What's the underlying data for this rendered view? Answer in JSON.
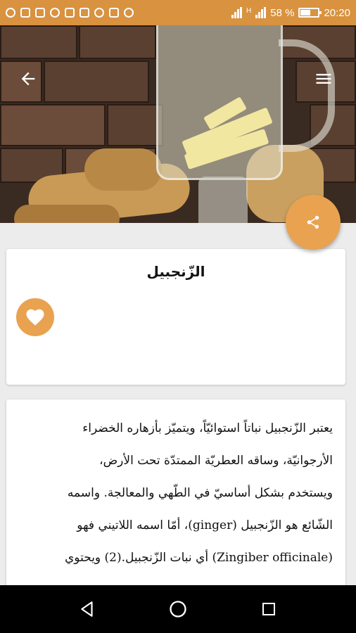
{
  "status_bar": {
    "battery_percent": "58 %",
    "time": "20:20",
    "notification_icons": [
      "hotspot-icon",
      "sim-icon",
      "facebook-icon",
      "messenger-icon",
      "gallery-icon",
      "app-icon",
      "app-icon-2",
      "instagram-icon",
      "messenger-icon-2"
    ],
    "signal_label": "H",
    "battery_level": 0.58
  },
  "toolbar": {
    "back_icon": "arrow-back-icon",
    "menu_icon": "menu-icon"
  },
  "article": {
    "title": "الزّنجبيل",
    "share_icon": "share-icon",
    "favorite_icon": "heart-icon",
    "content_lines": [
      "يعتبر الزّنجبيل نباتاً استوائيّاً، ويتميّز بأزهاره الخضراء",
      "الأرجوانيّة، وساقه العطريّة الممتدّة تحت الأرض،",
      "ويستخدم بشكل أساسيّ في الطّهي والمعالجة. واسمه",
      "الشّائع هو الزّنجبيل (ginger)، أمّا اسمه اللاتيني فهو",
      "(Zingiber officinale) أي نبات الزّنجبيل.(2) ويحتوي"
    ]
  },
  "nav_bar": {
    "back": "back-triangle-icon",
    "home": "home-circle-icon",
    "recents": "recents-square-icon"
  },
  "colors": {
    "accent": "#e9a250",
    "status_bar": "#d9923f"
  }
}
